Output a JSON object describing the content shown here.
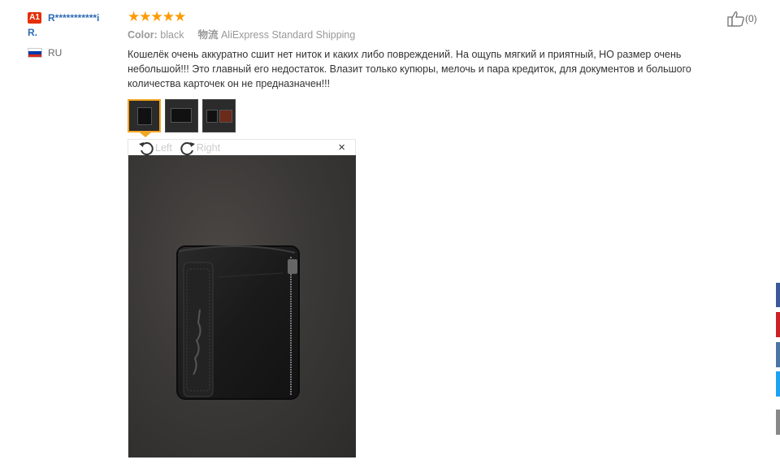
{
  "user": {
    "badge": "A1",
    "name": "R***********i",
    "name_line2": "R.",
    "country": "RU"
  },
  "review": {
    "stars": "★★★★★",
    "rating": 5,
    "color_label": "Color:",
    "color_value": "black",
    "shipping_label": "物流",
    "shipping_value": "AliExpress Standard Shipping",
    "text": "Кошелёк очень аккуратно сшит нет ниток и каких либо повреждений. На ощупь мягкий и приятный, НО размер очень небольшой!!! Это главный его недостаток. Влазит только купюры, мелочь и пара кредиток, для документов и большого количества карточек он не предназначен!!!"
  },
  "helpful": {
    "count": "(0)"
  },
  "viewer": {
    "rotate_left": "Left",
    "rotate_right": "Right",
    "close": "×"
  },
  "colors": {
    "accent": "#ff9a00",
    "link": "#2d6bb3",
    "badge": "#e62e04",
    "share_buttons": [
      "#3b5998",
      "#cb2027",
      "#4c75a3",
      "#1da1f2",
      "#ffffff",
      "#888888"
    ]
  }
}
